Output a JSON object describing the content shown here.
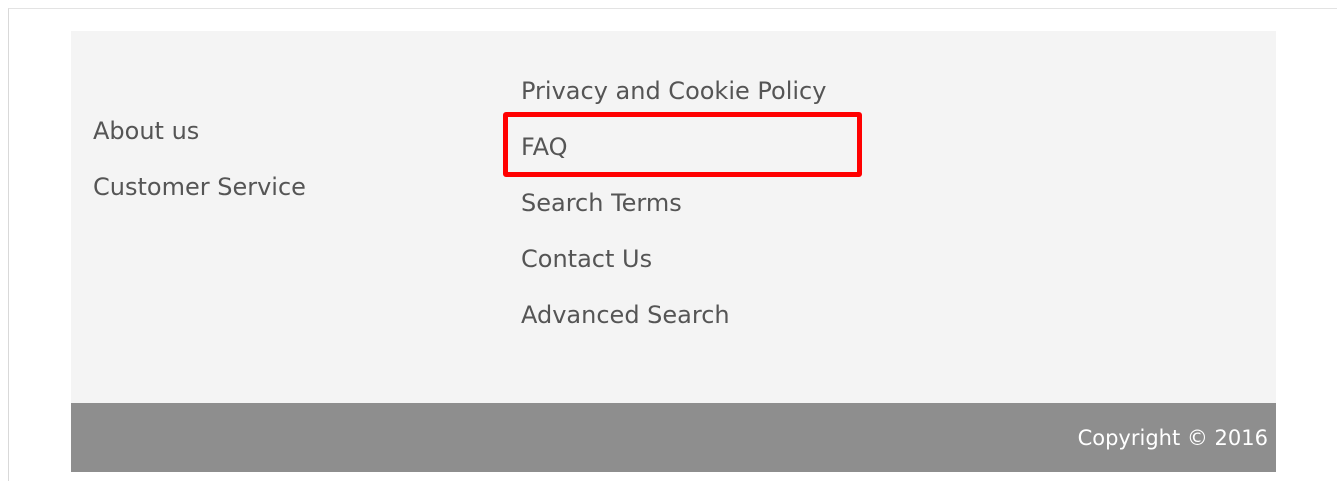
{
  "footer": {
    "column_left": [
      {
        "label": "About us"
      },
      {
        "label": "Customer Service"
      }
    ],
    "column_right": [
      {
        "label": "Privacy and Cookie Policy"
      },
      {
        "label": "FAQ"
      },
      {
        "label": "Search Terms"
      },
      {
        "label": "Contact Us"
      },
      {
        "label": "Advanced Search"
      }
    ]
  },
  "copyright": {
    "text": "Copyright © 2016"
  },
  "highlight": {
    "target": "FAQ",
    "color": "#ff0000"
  },
  "colors": {
    "footer_background": "#f4f4f4",
    "link_text": "#555555",
    "copyright_background": "#8e8e8e",
    "copyright_text": "#ffffff"
  }
}
